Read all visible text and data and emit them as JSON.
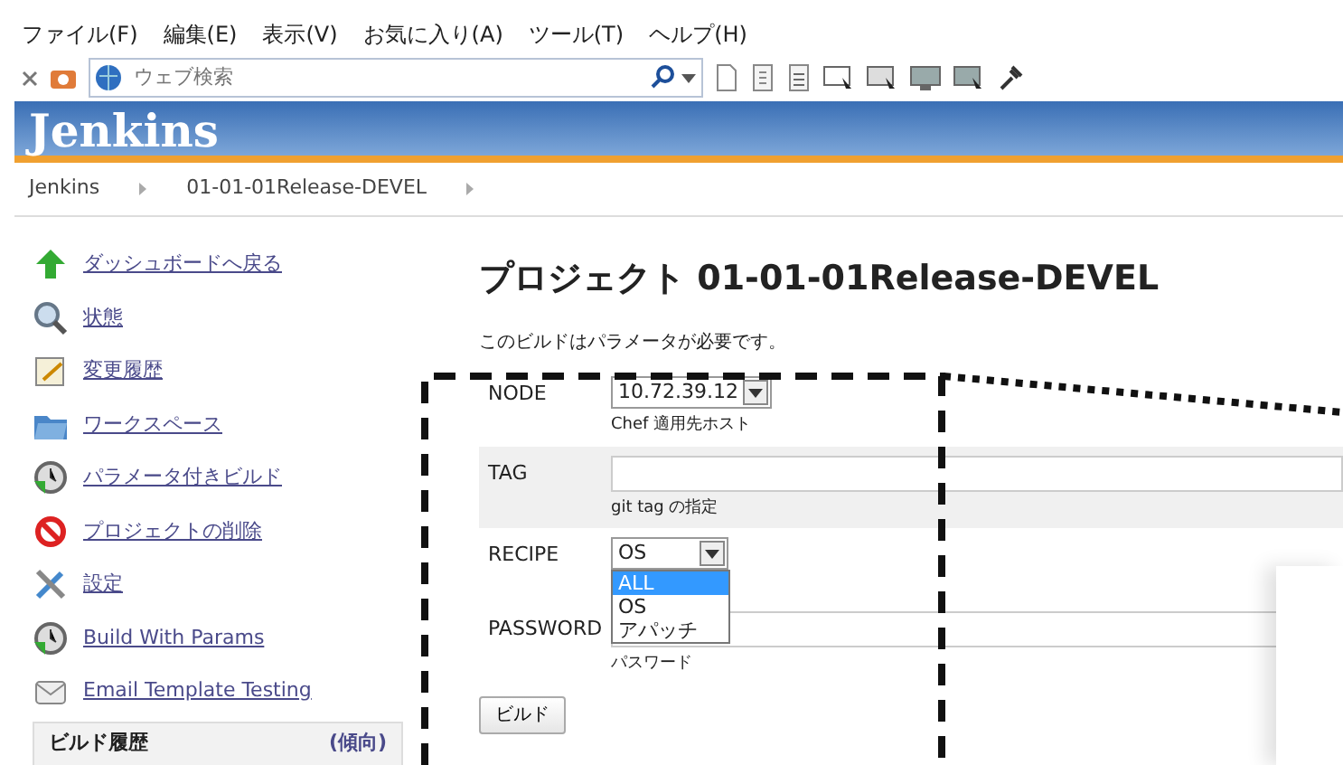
{
  "menu_bar": [
    "ファイル(F)",
    "編集(E)",
    "表示(V)",
    "お気に入り(A)",
    "ツール(T)",
    "ヘルプ(H)"
  ],
  "toolbar": {
    "search": {
      "placeholder": "ウェブ検索"
    }
  },
  "header": {
    "title": "Jenkins"
  },
  "breadcrumb": [
    "Jenkins",
    "01-01-01Release-DEVEL"
  ],
  "sidebar": {
    "items": [
      {
        "kind": "up",
        "label": "ダッシュボードへ戻る"
      },
      {
        "kind": "search",
        "label": "状態"
      },
      {
        "kind": "notepad",
        "label": "変更履歴"
      },
      {
        "kind": "folder",
        "label": "ワークスペース"
      },
      {
        "kind": "clock",
        "label": "パラメータ付きビルド"
      },
      {
        "kind": "forbidden",
        "label": "プロジェクトの削除"
      },
      {
        "kind": "tools",
        "label": "設定"
      },
      {
        "kind": "clock",
        "label": "Build With Params"
      },
      {
        "kind": "envelope",
        "label": "Email Template Testing"
      }
    ],
    "history": {
      "title": "ビルド履歴",
      "trend": "(傾向)"
    }
  },
  "page": {
    "title": "プロジェクト 01-01-01Release-DEVEL",
    "note": "このビルドはパラメータが必要です。"
  },
  "parameters": [
    {
      "kind": "select",
      "name": "NODE",
      "value": "10.72.39.12",
      "description": "Chef 適用先ホスト",
      "shaded": false
    },
    {
      "kind": "text",
      "name": "TAG",
      "description": "git tag の指定",
      "shaded": true
    },
    {
      "kind": "select",
      "name": "RECIPE",
      "value": "OS",
      "shaded": false,
      "expanded": true,
      "options": [
        {
          "label": "ALL",
          "highlighted": true
        },
        {
          "label": "OS",
          "highlighted": false
        },
        {
          "label": "アパッチ",
          "highlighted": false
        }
      ]
    },
    {
      "kind": "text",
      "name": "PASSWORD",
      "description": "パスワード",
      "shaded": false
    }
  ],
  "build_button": "ビルド"
}
